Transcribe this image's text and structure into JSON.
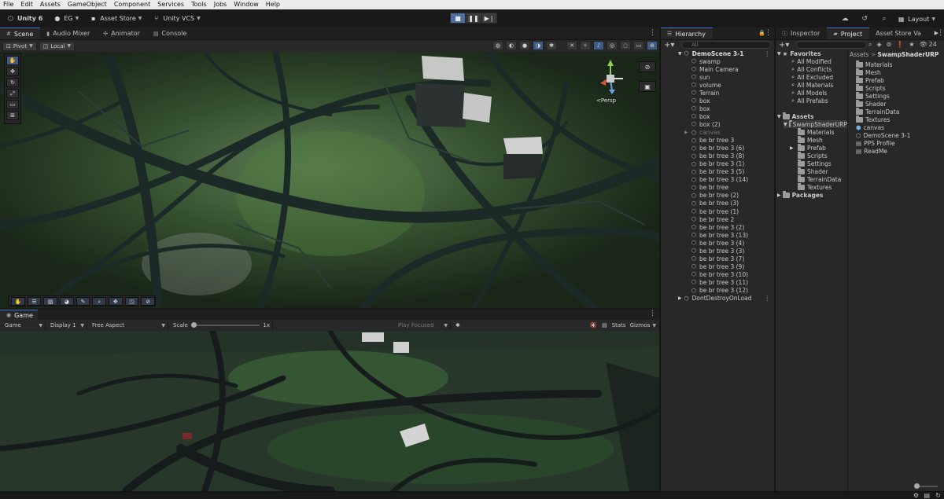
{
  "menu": [
    "File",
    "Edit",
    "Assets",
    "GameObject",
    "Component",
    "Services",
    "Tools",
    "Jobs",
    "Window",
    "Help"
  ],
  "toolbar": {
    "unity_label": "Unity 6",
    "account": "EG",
    "asset_store": "Asset Store",
    "vcs": "Unity VCS",
    "layout": "Layout"
  },
  "scene_tabs": [
    {
      "label": "Scene",
      "icon": "grid-icon"
    },
    {
      "label": "Audio Mixer",
      "icon": "mixer-icon"
    },
    {
      "label": "Animator",
      "icon": "animator-icon"
    },
    {
      "label": "Console",
      "icon": "console-icon"
    }
  ],
  "scene": {
    "pivot": "Pivot",
    "local": "Local",
    "persp": "<Persp"
  },
  "game": {
    "tab": "Game",
    "mode": "Game",
    "display": "Display 1",
    "aspect": "Free Aspect",
    "scale_label": "Scale",
    "scale_value": "1x",
    "play_focused": "Play Focused",
    "stats": "Stats",
    "gizmos": "Gizmos"
  },
  "hierarchy": {
    "tab": "Hierarchy",
    "search_placeholder": "All",
    "scene": "DemoScene 3-1",
    "items": [
      "swamp",
      "Main Camera",
      "sun",
      "volume",
      "Terrain",
      "box",
      "box",
      "box",
      "box (2)",
      "canvas",
      "be br tree 3",
      "be br tree 3 (6)",
      "be br tree 3 (8)",
      "be br tree 3 (1)",
      "be br tree 3 (5)",
      "be br tree 3 (14)",
      "be br tree",
      "be br tree (2)",
      "be br tree (3)",
      "be br tree (1)",
      "be br tree 2",
      "be br tree 3 (2)",
      "be br tree 3 (13)",
      "be br tree 3 (4)",
      "be br tree 3 (3)",
      "be br tree 3 (7)",
      "be br tree 3 (9)",
      "be br tree 3 (10)",
      "be br tree 3 (11)",
      "be br tree 3 (12)"
    ],
    "dont_destroy": "DontDestroyOnLoad"
  },
  "right_tabs": {
    "inspector": "Inspector",
    "project": "Project",
    "asset_store": "Asset Store Va"
  },
  "project": {
    "count": "24",
    "favorites_label": "Favorites",
    "favorites": [
      "All Modified",
      "All Conflicts",
      "All Excluded",
      "All Materials",
      "All Models",
      "All Prefabs"
    ],
    "assets_label": "Assets",
    "selected_folder": "SwampShaderURP",
    "tree_children": [
      "Materials",
      "Mesh",
      "Prefab",
      "Scripts",
      "Settings",
      "Shader",
      "TerrainData",
      "Textures"
    ],
    "packages_label": "Packages",
    "breadcrumb_root": "Assets",
    "breadcrumb_current": "SwampShaderURP",
    "content": [
      {
        "name": "Materials",
        "kind": "folder"
      },
      {
        "name": "Mesh",
        "kind": "folder"
      },
      {
        "name": "Prefab",
        "kind": "folder"
      },
      {
        "name": "Scripts",
        "kind": "folder"
      },
      {
        "name": "Settings",
        "kind": "folder"
      },
      {
        "name": "Shader",
        "kind": "folder"
      },
      {
        "name": "TerrainData",
        "kind": "folder"
      },
      {
        "name": "Textures",
        "kind": "folder"
      },
      {
        "name": "canvas",
        "kind": "prefab"
      },
      {
        "name": "DemoScene 3-1",
        "kind": "scene"
      },
      {
        "name": "PPS Profile",
        "kind": "asset"
      },
      {
        "name": "ReadMe",
        "kind": "asset"
      }
    ]
  },
  "colors": {
    "accent": "#3a73c9",
    "panel": "#282828",
    "menubar": "#ececec"
  }
}
